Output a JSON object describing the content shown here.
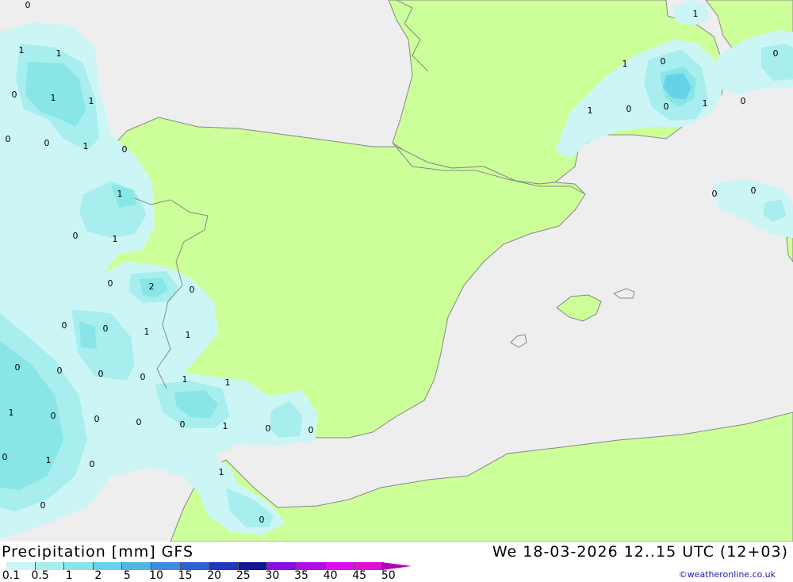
{
  "header": {
    "title": "Precipitation [mm] GFS",
    "datetime": "We 18-03-2026 12..15 UTC (12+03)"
  },
  "legend": {
    "ticks": [
      "0.1",
      "0.5",
      "1",
      "2",
      "5",
      "10",
      "15",
      "20",
      "25",
      "30",
      "35",
      "40",
      "45",
      "50"
    ],
    "colors": [
      "#ccf6f6",
      "#a8eeee",
      "#88e6e6",
      "#66d2ea",
      "#4fb4e6",
      "#3d8ce2",
      "#2e60d6",
      "#2236be",
      "#121496",
      "#8a0ee6",
      "#b40ee6",
      "#dc0eee",
      "#e20ed4",
      "#b000b8"
    ]
  },
  "credit": "©weatheronline.co.uk",
  "colors": {
    "sea": "#eeeeee",
    "land": "#ccff99",
    "border": "#888888"
  },
  "map_labels": [
    "0",
    "1",
    "1",
    "0",
    "1",
    "1",
    "0",
    "0",
    "1",
    "0",
    "1",
    "0",
    "1",
    "0",
    "2",
    "0",
    "0",
    "0",
    "1",
    "1",
    "0",
    "0",
    "0",
    "0",
    "1",
    "1",
    "1",
    "0",
    "0",
    "0",
    "0",
    "1",
    "0",
    "0",
    "0",
    "1",
    "0",
    "1",
    "0",
    "0",
    "1",
    "1",
    "0",
    "0",
    "1",
    "0",
    "0"
  ]
}
